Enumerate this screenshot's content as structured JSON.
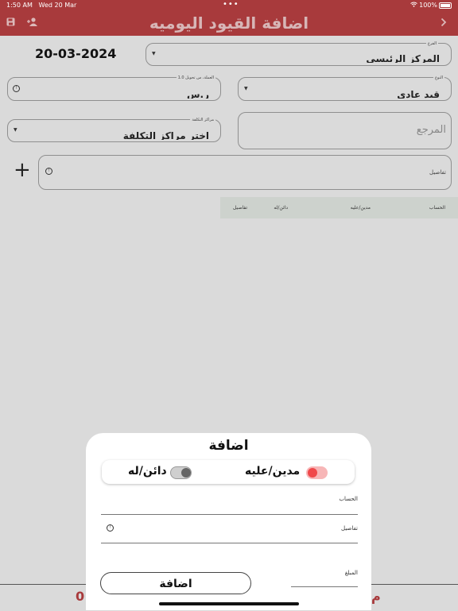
{
  "status": {
    "time": "1:50 AM",
    "date": "Wed 20 Mar",
    "dots": "•••",
    "battery": "100%"
  },
  "nav": {
    "title": "اضافة القيود اليوميه",
    "back_icon": "chevron-right-icon",
    "save_icon": "save-icon",
    "user_icon": "add-user-icon"
  },
  "form": {
    "date": "20-03-2024",
    "branch": {
      "label": "الفرع",
      "value": "المركز الرئيسي"
    },
    "type": {
      "label": "النوع",
      "value": "قيد عادي"
    },
    "currency": {
      "label": "العملة، س تحويل 1.0",
      "value": "ر.س"
    },
    "cost_center": {
      "label": "مراكز التكلفة",
      "value": "اختر مراكز التكلفة"
    },
    "reference": {
      "placeholder": "المرجع"
    },
    "details": {
      "label": "تفاصيل"
    },
    "add_symbol": "+"
  },
  "table": {
    "columns": [
      "الحساب",
      "مدين/عليه",
      "دائن/له",
      "تفاصيل"
    ]
  },
  "bottom": {
    "left_value": "0",
    "right_value": "م"
  },
  "sheet": {
    "title": "اضافة",
    "debit_label": "مدين/عليه",
    "credit_label": "دائن/له",
    "account_label": "الحساب",
    "details_label": "تفاصيل",
    "amount_label": "المبلغ",
    "submit_label": "اضافة",
    "debit_on": true,
    "credit_on": false,
    "accent": "#f0484a"
  }
}
